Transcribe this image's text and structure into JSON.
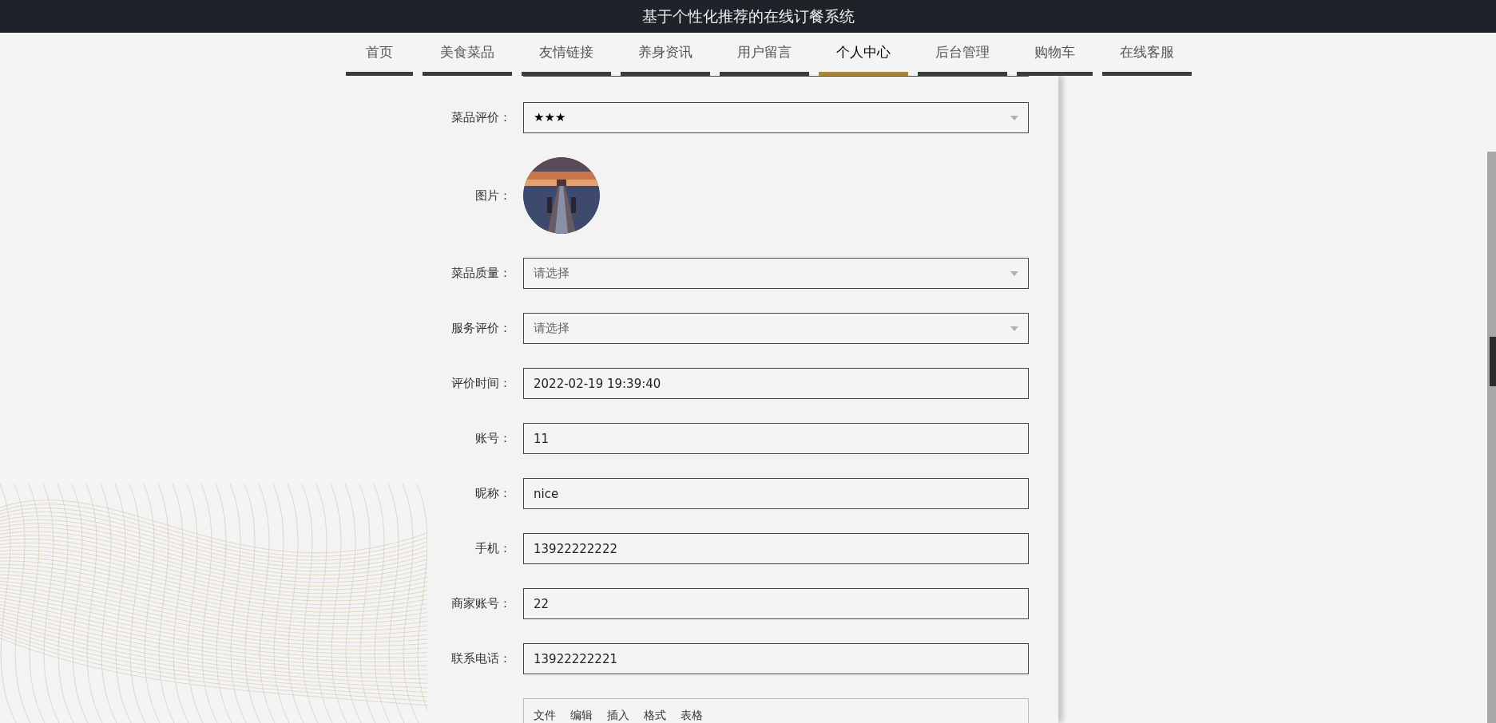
{
  "title": "基于个性化推荐的在线订餐系统",
  "nav": [
    {
      "label": "首页",
      "selected": false
    },
    {
      "label": "美食菜品",
      "selected": false
    },
    {
      "label": "友情链接",
      "selected": false
    },
    {
      "label": "养身资讯",
      "selected": false
    },
    {
      "label": "用户留言",
      "selected": false
    },
    {
      "label": "个人中心",
      "selected": true
    },
    {
      "label": "后台管理",
      "selected": false
    },
    {
      "label": "购物车",
      "selected": false
    },
    {
      "label": "在线客服",
      "selected": false
    }
  ],
  "form": {
    "fields": [
      {
        "kind": "select",
        "label": "菜品评价：",
        "value": "★★★"
      },
      {
        "label": "图片："
      },
      {
        "kind": "select",
        "label": "菜品质量：",
        "placeholder": "请选择"
      },
      {
        "kind": "select",
        "label": "服务评价：",
        "placeholder": "请选择"
      },
      {
        "kind": "text",
        "label": "评价时间：",
        "value": "2022-02-19 19:39:40"
      },
      {
        "kind": "text",
        "label": "账号：",
        "value": "11"
      },
      {
        "kind": "text",
        "label": "昵称：",
        "value": "nice"
      },
      {
        "kind": "text",
        "label": "手机：",
        "value": "13922222222"
      },
      {
        "kind": "text",
        "label": "商家账号：",
        "value": "22"
      },
      {
        "kind": "text",
        "label": "联系电话：",
        "value": "13922222221"
      },
      {
        "kind": "editor",
        "menu": [
          "文件",
          "编辑",
          "插入",
          "格式",
          "表格"
        ]
      }
    ]
  }
}
